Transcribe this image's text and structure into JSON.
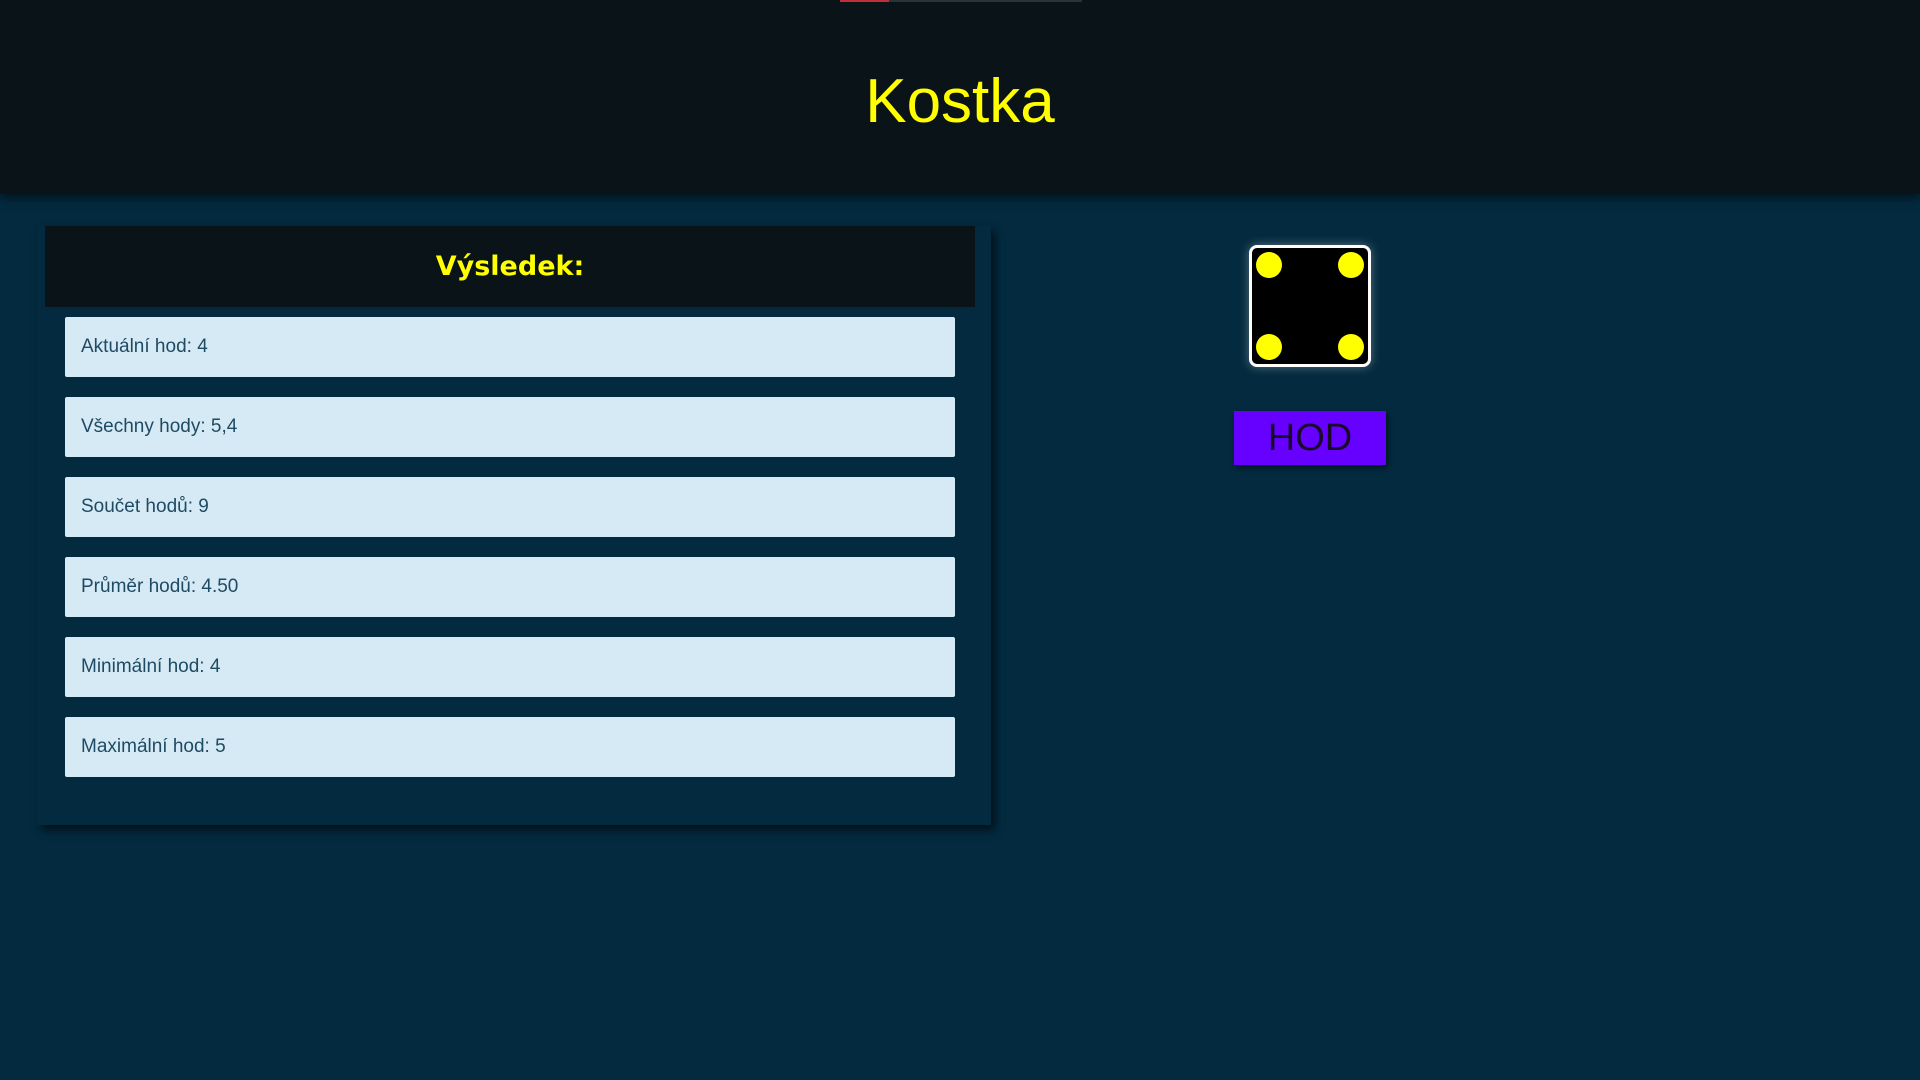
{
  "header": {
    "title": "Kostka"
  },
  "results": {
    "heading": "Výsledek:",
    "current_roll": "Aktuální hod: 4",
    "all_rolls": "Všechny hody: 5,4",
    "sum": "Součet hodů: 9",
    "average": "Průměr hodů: 4.50",
    "min": "Minimální hod: 4",
    "max": "Maximální hod: 5"
  },
  "die": {
    "face_value": 4,
    "pip_color": "#ffff00",
    "face_color": "#000000"
  },
  "roll_button": {
    "label": "HOD",
    "color": "#6600ff"
  },
  "colors": {
    "background": "#032a3f",
    "header_background": "#0a1317",
    "accent_text": "#ffff00",
    "row_background": "#d6eaf5"
  }
}
